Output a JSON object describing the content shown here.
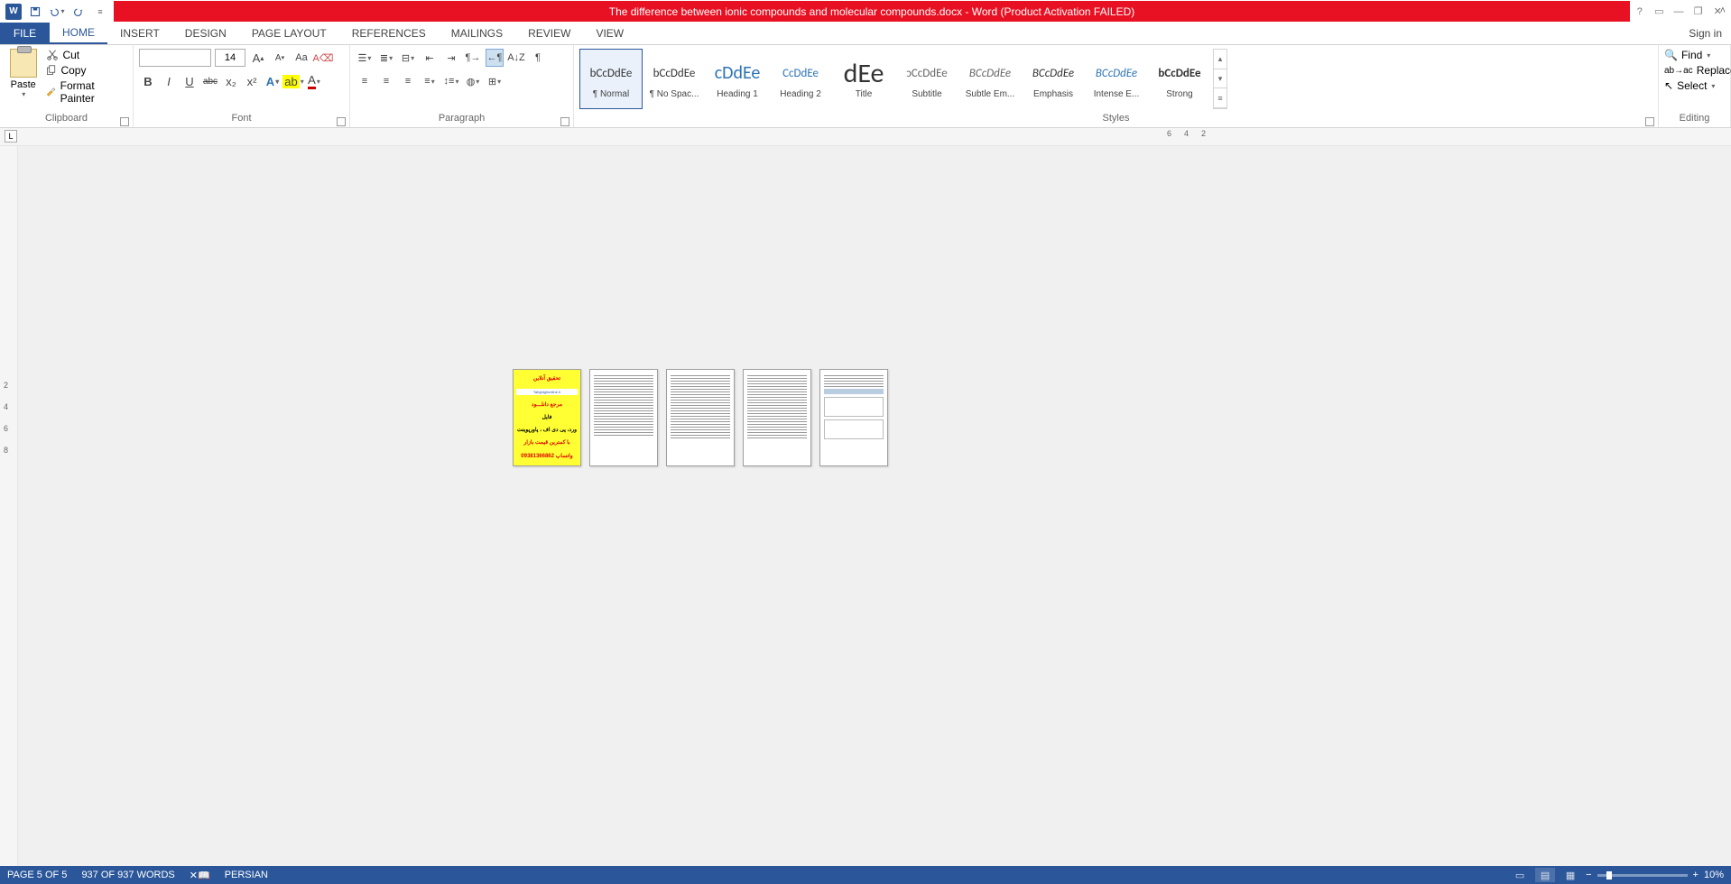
{
  "title": "The difference between ionic compounds and molecular compounds.docx -  Word (Product Activation FAILED)",
  "qat": {
    "save": "save",
    "undo": "undo",
    "redo": "redo"
  },
  "win": {
    "help": "?",
    "opts": "▭",
    "min": "—",
    "restore": "❐",
    "close": "✕"
  },
  "tabs": {
    "file": "FILE",
    "home": "HOME",
    "insert": "INSERT",
    "design": "DESIGN",
    "pagelayout": "PAGE LAYOUT",
    "references": "REFERENCES",
    "mailings": "MAILINGS",
    "review": "REVIEW",
    "view": "VIEW",
    "signin": "Sign in"
  },
  "clipboard": {
    "paste": "Paste",
    "cut": "Cut",
    "copy": "Copy",
    "format_painter": "Format Painter",
    "label": "Clipboard"
  },
  "font": {
    "name": "",
    "size": "14",
    "grow": "A",
    "shrink": "A",
    "case": "Aa",
    "clear": "⌫",
    "bold": "B",
    "italic": "I",
    "underline": "U",
    "strike": "abc",
    "sub": "x₂",
    "sup": "x²",
    "label": "Font"
  },
  "paragraph": {
    "label": "Paragraph"
  },
  "styles": {
    "label": "Styles",
    "items": [
      {
        "prev": "bCcDdEe",
        "name": "¶ Normal",
        "sel": true,
        "color": "#333"
      },
      {
        "prev": "bCcDdEe",
        "name": "¶ No Spac...",
        "color": "#333"
      },
      {
        "prev": "cDdEe",
        "name": "Heading 1",
        "color": "#2e74b5",
        "big": true
      },
      {
        "prev": "CcDdEe",
        "name": "Heading 2",
        "color": "#2e74b5"
      },
      {
        "prev": "dEe",
        "name": "Title",
        "color": "#333",
        "xbig": true
      },
      {
        "prev": "ↄCcDdEe",
        "name": "Subtitle",
        "color": "#666"
      },
      {
        "prev": "BCcDdEe",
        "name": "Subtle Em...",
        "color": "#666",
        "italic": true
      },
      {
        "prev": "BCcDdEe",
        "name": "Emphasis",
        "color": "#333",
        "italic": true
      },
      {
        "prev": "BCcDdEe",
        "name": "Intense E...",
        "color": "#2e74b5",
        "italic": true
      },
      {
        "prev": "bCcDdEe",
        "name": "Strong",
        "color": "#333",
        "bold": true
      }
    ]
  },
  "editing": {
    "find": "Find",
    "replace": "Replace",
    "select": "Select",
    "label": "Editing"
  },
  "ruler": {
    "marks": [
      "6",
      "4",
      "2"
    ],
    "left": "L"
  },
  "vruler": {
    "marks": [
      "2",
      "4",
      "6",
      "8"
    ]
  },
  "cover": {
    "l1": "تحقیق آنلاین",
    "l2": "Tahghighonline.ir",
    "l3": "مرجع دانلـــود",
    "l4": "فایل",
    "l5": "ورد، پی دی اف ، پاورپوینت",
    "l6": "با کمترین قیمت بازار",
    "l7": "09381366862 واتساپ"
  },
  "status": {
    "page": "PAGE 5 OF 5",
    "words": "937 OF 937 WORDS",
    "lang": "PERSIAN",
    "zoom": "10%"
  }
}
